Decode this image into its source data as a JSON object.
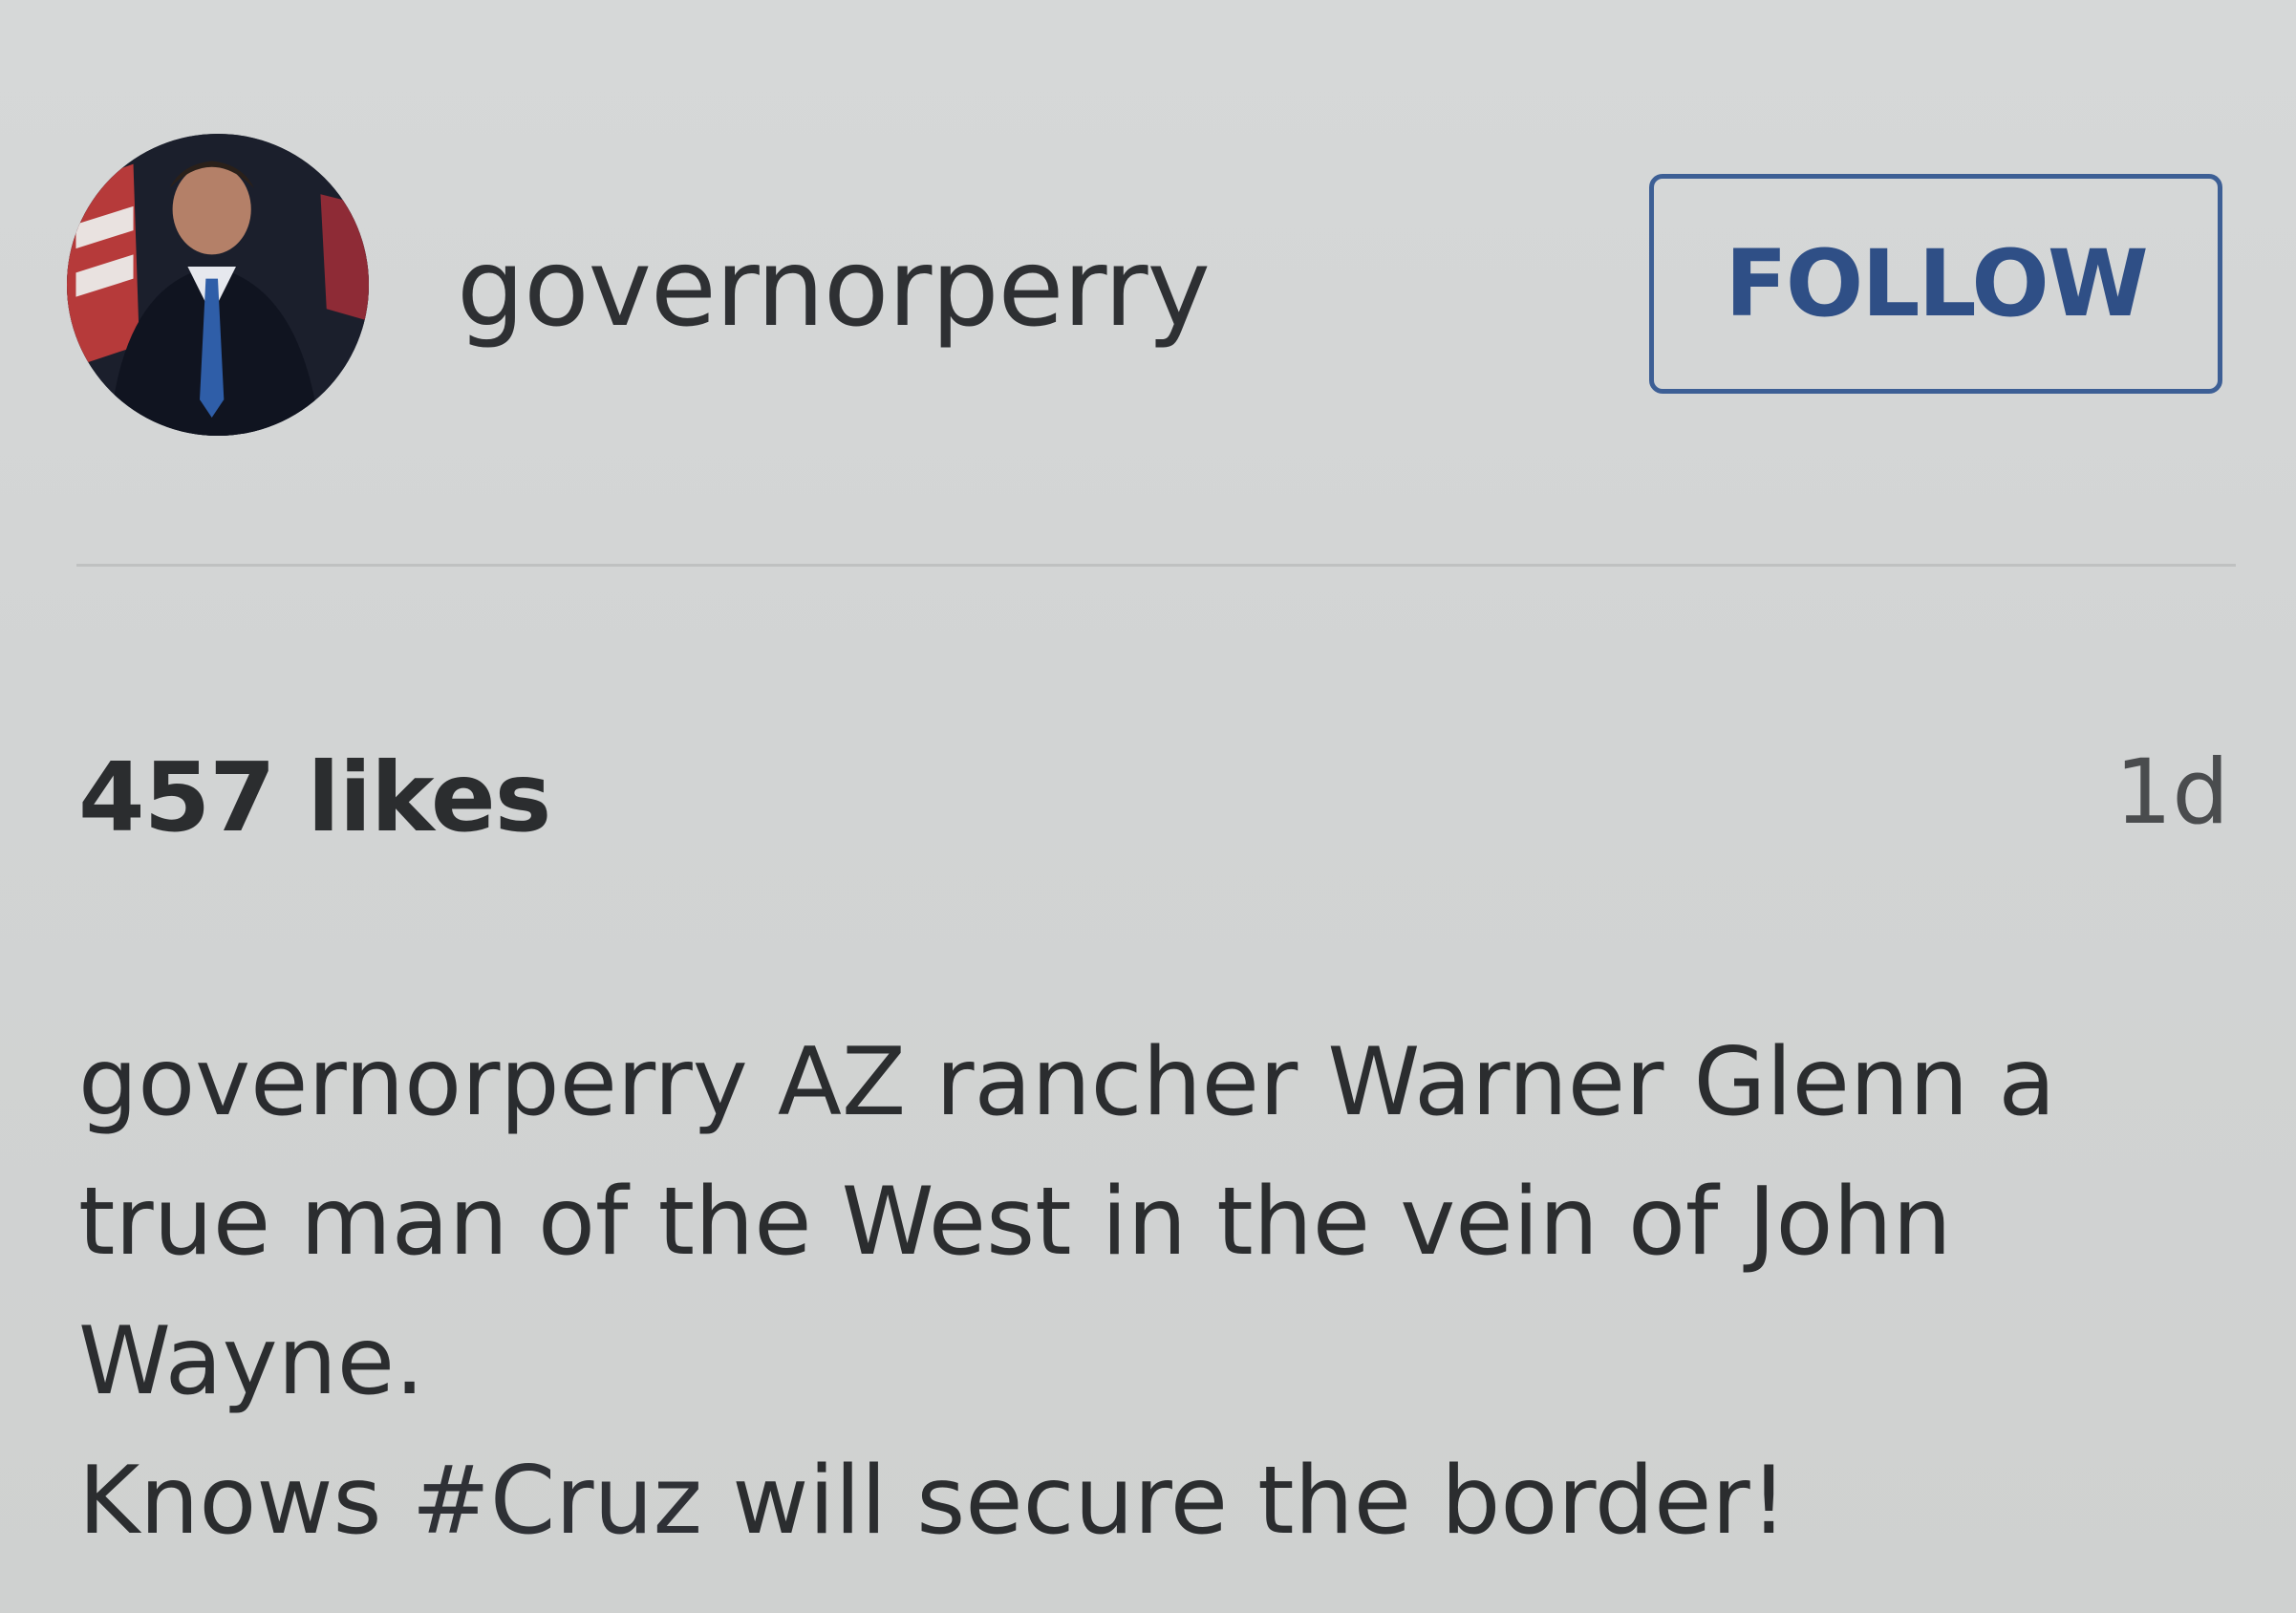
{
  "post": {
    "username": "governorperry",
    "follow_label": "FOLLOW",
    "likes": "457 likes",
    "time": "1d",
    "caption": {
      "user": "governorperry",
      "line1_rest": " AZ rancher Warner Glenn a",
      "line2": "true man of the West in the vein of John",
      "line3": "Wayne.",
      "line4_before": "Knows ",
      "hashtag": "#Cruz",
      "line4_after": " will secure the border!"
    }
  },
  "colors": {
    "background": "#d4d6d6",
    "follow_accent": "#3d5f95",
    "text": "#2b2d2f"
  },
  "icons": {
    "avatar": "profile-photo"
  }
}
